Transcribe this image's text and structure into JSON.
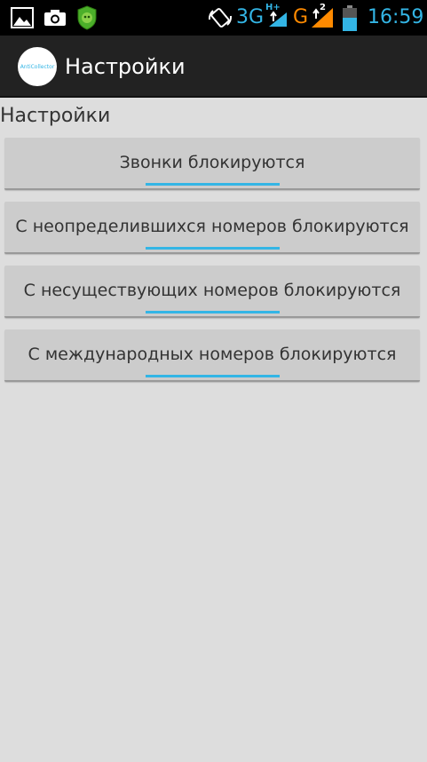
{
  "status_bar": {
    "net_3g": "3G",
    "net_hplus": "H+",
    "net_g": "G",
    "sim2": "2",
    "clock": "16:59",
    "icons": [
      "gallery-icon",
      "camera-icon",
      "shield-icon",
      "rotate-icon",
      "data-arrows-icon",
      "signal-icon",
      "battery-icon"
    ],
    "accent_color": "#33b5e5",
    "g_color": "#ff8a00"
  },
  "action_bar": {
    "app_icon_text": "AntiCollector",
    "title": "Настройки"
  },
  "section": {
    "title": "Настройки"
  },
  "toggles": [
    {
      "label": "Звонки блокируются",
      "on": true
    },
    {
      "label": "С неопределившихся номеров блокируются",
      "on": true
    },
    {
      "label": "С несуществующих номеров блокируются",
      "on": true
    },
    {
      "label": "С международных номеров блокируются",
      "on": true
    }
  ],
  "colors": {
    "background": "#dddddd",
    "button": "#cccccc",
    "indicator_on": "#33b5e5",
    "action_bar": "#222222"
  }
}
